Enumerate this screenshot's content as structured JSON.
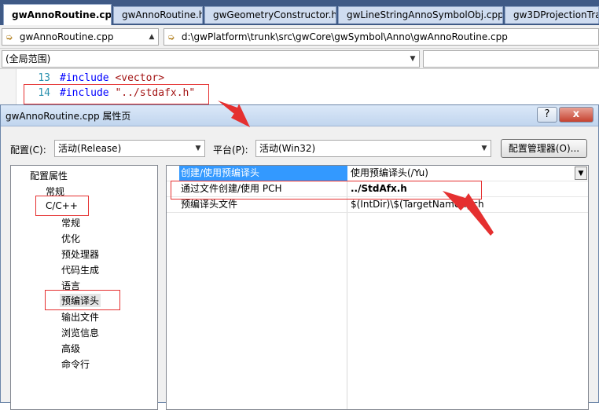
{
  "tabs": [
    {
      "label": "gwAnnoRoutine.cpp",
      "active": true
    },
    {
      "label": "gwAnnoRoutine.h",
      "active": false
    },
    {
      "label": "gwGeometryConstructor.h",
      "active": false
    },
    {
      "label": "gwLineStringAnnoSymbolObj.cpp",
      "active": false
    },
    {
      "label": "gw3DProjectionTra",
      "active": false
    }
  ],
  "nav": {
    "file_combo": "gwAnnoRoutine.cpp",
    "path_combo": "d:\\gwPlatform\\trunk\\src\\gwCore\\gwSymbol\\Anno\\gwAnnoRoutine.cpp",
    "scope_combo": "(全局范围)"
  },
  "code": {
    "lines": [
      {
        "no": "13",
        "keyword": "#include",
        "arg": "<vector>"
      },
      {
        "no": "14",
        "keyword": "#include",
        "arg": "\"../stdafx.h\""
      }
    ]
  },
  "dialog": {
    "title": "gwAnnoRoutine.cpp 属性页",
    "help_label": "?",
    "close_label": "x",
    "config_label": "配置(C):",
    "config_value": "活动(Release)",
    "platform_label": "平台(P):",
    "platform_value": "活动(Win32)",
    "config_manager_label": "配置管理器(O)..."
  },
  "tree": {
    "root": "配置属性",
    "general": "常规",
    "cpp": "C/C++",
    "cpp_children": [
      "常规",
      "优化",
      "预处理器",
      "代码生成",
      "语言",
      "预编译头",
      "输出文件",
      "浏览信息",
      "高级",
      "命令行"
    ]
  },
  "properties": [
    {
      "name": "创建/使用预编译头",
      "value": "使用预编译头(/Yu)"
    },
    {
      "name": "通过文件创建/使用 PCH",
      "value": "../StdAfx.h"
    },
    {
      "name": "预编译头文件",
      "value": "$(IntDir)\\$(TargetName).pch"
    }
  ],
  "colors": {
    "tab_bg": "#3f5a86",
    "selection": "#3399ff",
    "annotation": "#e53030"
  }
}
